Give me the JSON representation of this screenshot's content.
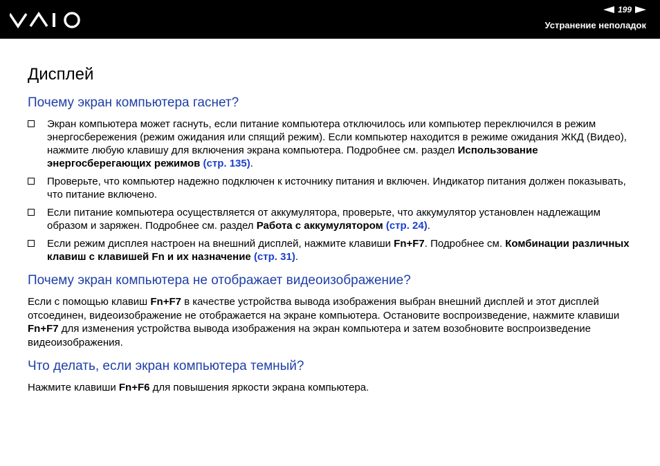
{
  "header": {
    "brand": "VAIO",
    "page_number": "199",
    "section": "Устранение неполадок"
  },
  "page": {
    "title": "Дисплей"
  },
  "sec1": {
    "heading": "Почему экран компьютера гаснет?",
    "b1": {
      "text": "Экран компьютера может гаснуть, если питание компьютера отключилось или компьютер переключился в режим энергосбережения (режим ожидания или спящий режим). Если компьютер находится в режиме ожидания ЖКД (Видео), нажмите любую клавишу для включения экрана компьютера. Подробнее см. раздел ",
      "bold": "Использование энергосберегающих режимов",
      "link": "(стр. 135)",
      "end": "."
    },
    "b2": {
      "text": "Проверьте, что компьютер надежно подключен к источнику питания и включен. Индикатор питания должен показывать, что питание включено."
    },
    "b3": {
      "text": "Если питание компьютера осуществляется от аккумулятора, проверьте, что аккумулятор установлен надлежащим образом и заряжен. Подробнее см. раздел ",
      "bold": "Работа с аккумулятором",
      "link": "(стр. 24)",
      "end": "."
    },
    "b4": {
      "text": "Если режим дисплея настроен на внешний дисплей, нажмите клавиши ",
      "key": "Fn+F7",
      "mid": ". Подробнее см. ",
      "bold": "Комбинации различных клавиш с клавишей Fn и их назначение",
      "link": "(стр. 31)",
      "end": "."
    }
  },
  "sec2": {
    "heading": "Почему экран компьютера не отображает видеоизображение?",
    "t1": "Если с помощью клавиш ",
    "k1": "Fn+F7",
    "t2": " в качестве устройства вывода изображения выбран внешний дисплей и этот дисплей отсоединен, видеоизображение не отображается на экране компьютера. Остановите воспроизведение, нажмите клавиши ",
    "k2": "Fn+F7",
    "t3": " для изменения устройства вывода изображения на экран компьютера и затем возобновите воспроизведение видеоизображения."
  },
  "sec3": {
    "heading": "Что делать, если экран компьютера темный?",
    "t1": "Нажмите клавиши ",
    "k1": "Fn+F6",
    "t2": " для повышения яркости экрана компьютера."
  }
}
